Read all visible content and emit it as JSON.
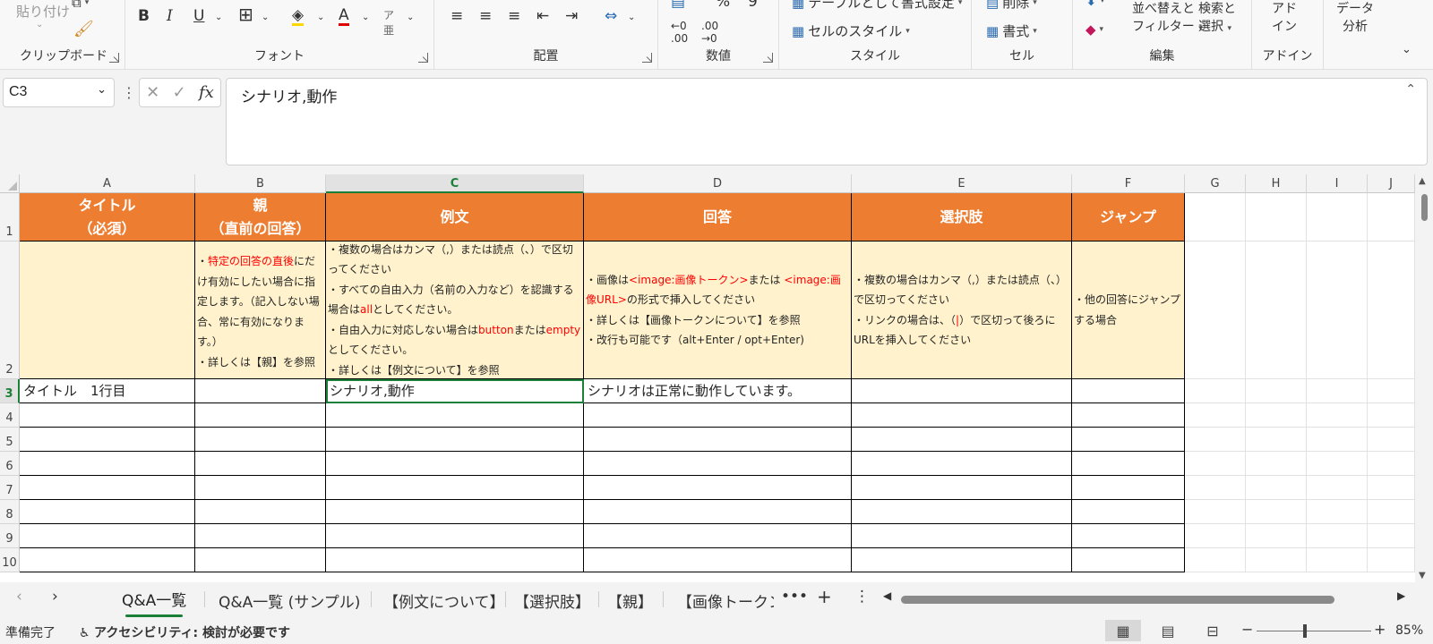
{
  "ribbon": {
    "clipboard": {
      "paste_label": "貼り付け",
      "group_label": "クリップボード"
    },
    "font": {
      "group_label": "フォント",
      "bold": "B",
      "italic": "I",
      "underline": "U"
    },
    "alignment": {
      "group_label": "配置"
    },
    "number": {
      "group_label": "数値"
    },
    "styles": {
      "table_format_label": "テーブルとして書式設定",
      "cell_styles_label": "セルのスタイル",
      "group_label": "スタイル"
    },
    "cells": {
      "delete_label": "削除",
      "format_label": "書式",
      "group_label": "セル"
    },
    "editing": {
      "sort_filter_line1": "並べ替えと",
      "sort_filter_line2": "フィルター",
      "find_select_line1": "検索と",
      "find_select_line2": "選択",
      "group_label": "編集"
    },
    "addins": {
      "line1": "アド",
      "line2": "イン",
      "group_label": "アドイン"
    },
    "data_analysis": {
      "line1": "データ",
      "line2": "分析"
    }
  },
  "formula_bar": {
    "name_box": "C3",
    "fx_label": "fx",
    "content": "シナリオ,動作"
  },
  "columns": [
    "A",
    "B",
    "C",
    "D",
    "E",
    "F",
    "G",
    "H",
    "I",
    "J"
  ],
  "rows": [
    "1",
    "2",
    "3",
    "4",
    "5",
    "6",
    "7",
    "8",
    "9",
    "10"
  ],
  "header_row": {
    "a_line1": "タイトル",
    "a_line2": "（必須）",
    "b_line1": "親",
    "b_line2": "（直前の回答）",
    "c": "例文",
    "d": "回答",
    "e": "選択肢",
    "f": "ジャンプ"
  },
  "desc_row": {
    "b": {
      "p1_a": "・",
      "p1_red": "特定の回答の直後",
      "p1_b": "にだけ有効にしたい場合に指定します。（記入しない場合、常に有効になります。）",
      "p2": "・詳しくは【親】を参照"
    },
    "c": {
      "p1": "・複数の場合はカンマ（,）または読点（、）で区切ってください",
      "p2_a": "・すべての自由入力（名前の入力など）を認識する場合は",
      "p2_red": "all",
      "p2_b": "としてください。",
      "p3_a": "・自由入力に対応しない場合は",
      "p3_red1": "button",
      "p3_b": "または",
      "p3_red2": "empty",
      "p3_c": "としてください。",
      "p4": "・詳しくは【例文について】を参照"
    },
    "d": {
      "p1_a": "・画像は",
      "p1_red1": "<image:画像トークン>",
      "p1_b": "または ",
      "p1_red2": "<image:画像URL>",
      "p1_c": "の形式で挿入してください",
      "p2": "・詳しくは【画像トークンについて】を参照",
      "p3": "・改行も可能です（alt+Enter / opt+Enter)"
    },
    "e": {
      "p1": "・複数の場合はカンマ（,）または読点（、）で区切ってください",
      "p2_a": "・リンクの場合は、（",
      "p2_red": "|",
      "p2_b": "）で区切って後ろにURLを挿入してください"
    },
    "f": {
      "p1": "・他の回答にジャンプする場合"
    }
  },
  "data_row": {
    "a": "タイトル　1行目",
    "c": "シナリオ,動作",
    "d": "シナリオは正常に動作しています。"
  },
  "sheet_tabs": [
    "Q&A一覧",
    "Q&A一覧 (サンプル)",
    "【例文について】",
    "【選択肢】",
    "【親】",
    "【画像トークン("
  ],
  "active_tab": 0,
  "status": {
    "ready": "準備完了",
    "accessibility": "アクセシビリティ: 検討が必要です",
    "zoom": "85%"
  },
  "colors": {
    "header_orange": "#ed7d31",
    "desc_yellow": "#fff2cc",
    "accent_green": "#1a7f37"
  }
}
